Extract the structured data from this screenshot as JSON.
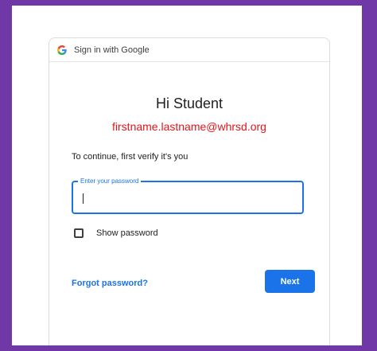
{
  "header": {
    "logo_icon": "google-g-icon",
    "text": "Sign in with Google"
  },
  "main": {
    "title": "Hi Student",
    "email": "firstname.lastname@whrsd.org",
    "subtitle": "To continue, first verify it's you"
  },
  "password": {
    "label": "Enter your password",
    "value": ""
  },
  "show_password": {
    "label": "Show password",
    "checked": false
  },
  "actions": {
    "forgot_label": "Forgot password?",
    "next_label": "Next"
  },
  "colors": {
    "frame": "#6f38a6",
    "accent": "#1a73e8",
    "email": "#e0161c"
  }
}
